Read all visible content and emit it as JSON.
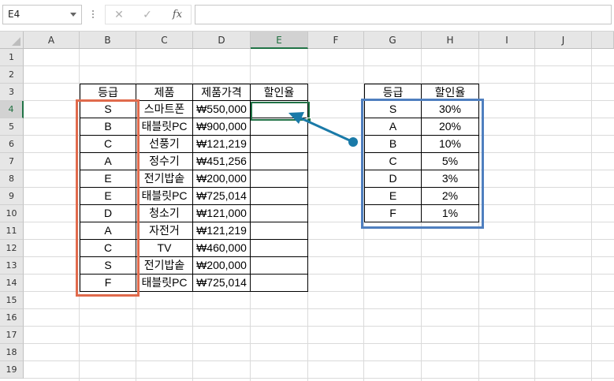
{
  "name_box": {
    "value": "E4"
  },
  "formula_bar": {
    "cancel_glyph": "✕",
    "enter_glyph": "✓",
    "fx_label": "fx",
    "content": ""
  },
  "columns": [
    "A",
    "B",
    "C",
    "D",
    "E",
    "F",
    "G",
    "H",
    "I",
    "J"
  ],
  "rows": [
    "1",
    "2",
    "3",
    "4",
    "5",
    "6",
    "7",
    "8",
    "9",
    "10",
    "11",
    "12",
    "13",
    "14",
    "15",
    "16",
    "17",
    "18",
    "19"
  ],
  "active_cell": {
    "column": "E",
    "row": "4"
  },
  "product_table": {
    "headers": [
      "등급",
      "제품",
      "제품가격",
      "할인율"
    ],
    "rows": [
      [
        "S",
        "스마트폰",
        "₩550,000",
        ""
      ],
      [
        "B",
        "태블릿PC",
        "₩900,000",
        ""
      ],
      [
        "C",
        "선풍기",
        "₩121,219",
        ""
      ],
      [
        "A",
        "정수기",
        "₩451,256",
        ""
      ],
      [
        "E",
        "전기밥솥",
        "₩200,000",
        ""
      ],
      [
        "E",
        "태블릿PC",
        "₩725,014",
        ""
      ],
      [
        "D",
        "청소기",
        "₩121,000",
        ""
      ],
      [
        "A",
        "자전거",
        "₩121,219",
        ""
      ],
      [
        "C",
        "TV",
        "₩460,000",
        ""
      ],
      [
        "S",
        "전기밥솥",
        "₩200,000",
        ""
      ],
      [
        "F",
        "태블릿PC",
        "₩725,014",
        ""
      ]
    ]
  },
  "discount_table": {
    "headers": [
      "등급",
      "할인율"
    ],
    "rows": [
      [
        "S",
        "30%"
      ],
      [
        "A",
        "20%"
      ],
      [
        "B",
        "10%"
      ],
      [
        "C",
        "5%"
      ],
      [
        "D",
        "3%"
      ],
      [
        "E",
        "2%"
      ],
      [
        "F",
        "1%"
      ]
    ]
  },
  "colors": {
    "selection_green": "#217346",
    "highlight_orange": "#e06a4c",
    "highlight_blue": "#4f7fbf",
    "arrow_teal": "#1a7aa8"
  }
}
